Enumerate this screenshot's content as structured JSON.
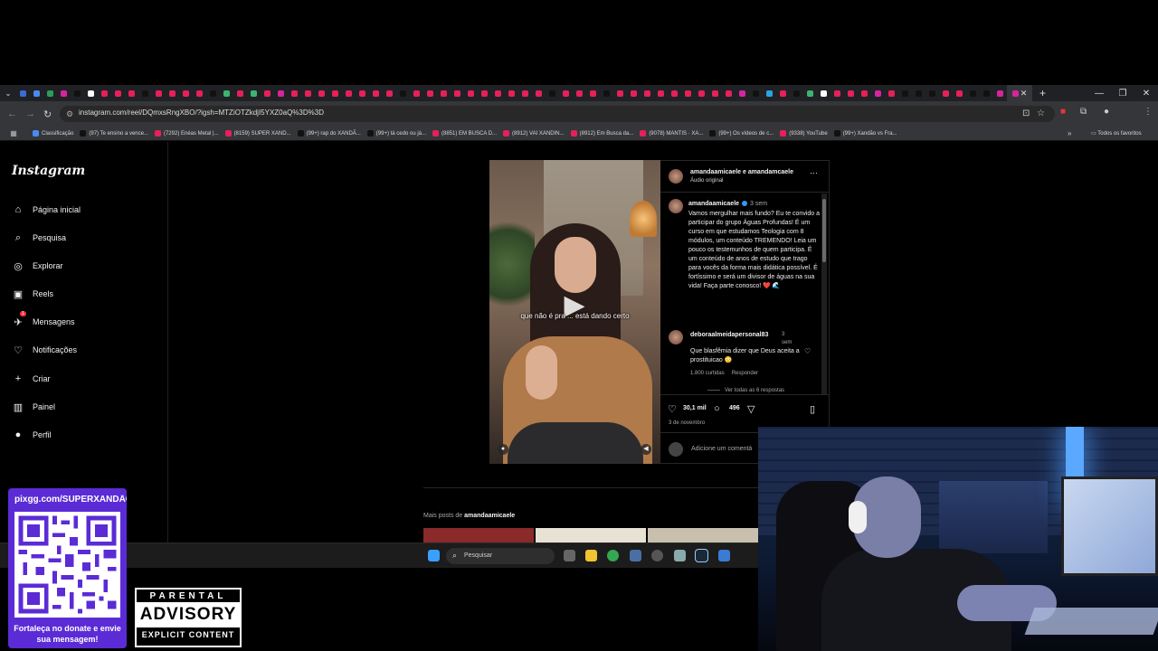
{
  "browser": {
    "url": "instagram.com/reel/DQmxsRngXBO/?igsh=MTZiOTZkdjI5YXZ0aQ%3D%3D",
    "tab_colors": [
      "#3b6bd6",
      "#4a8af4",
      "#2f9a5a",
      "#d6249f",
      "#111",
      "#fff",
      "#e6205a",
      "#e6205a",
      "#e6205a",
      "#111",
      "#e6205a",
      "#e6205a",
      "#e6205a",
      "#e6205a",
      "#111",
      "#3cb371",
      "#e6205a",
      "#3cb371",
      "#e6205a",
      "#d6249f",
      "#e6205a",
      "#e6205a",
      "#e6205a",
      "#e6205a",
      "#e6205a",
      "#e6205a",
      "#e6205a",
      "#e6205a",
      "#111",
      "#e6205a",
      "#e6205a",
      "#e6205a",
      "#e6205a",
      "#e6205a",
      "#e6205a",
      "#e6205a",
      "#e6205a",
      "#e6205a",
      "#e6205a",
      "#111",
      "#e6205a",
      "#e6205a",
      "#e6205a",
      "#111",
      "#e6205a",
      "#e6205a",
      "#e6205a",
      "#e6205a",
      "#e6205a",
      "#e6205a",
      "#e6205a",
      "#e6205a",
      "#e6205a",
      "#d6249f",
      "#111",
      "#2aa4e0",
      "#e6205a",
      "#111",
      "#3cb371",
      "#fff",
      "#e6205a",
      "#e6205a",
      "#e6205a",
      "#d6249f",
      "#e6205a",
      "#111",
      "#111",
      "#111",
      "#e6205a",
      "#e6205a",
      "#111",
      "#111",
      "#d6249f"
    ],
    "bookmarks": [
      {
        "label": "Classificação",
        "color": "#4a8af4"
      },
      {
        "label": "(97) Te ensino a vence...",
        "color": "#111"
      },
      {
        "label": "(7292) Enéas Metal |...",
        "color": "#e6205a"
      },
      {
        "label": "(8159) SUPER XAND...",
        "color": "#e6205a"
      },
      {
        "label": "(99+) rap do XANDÃ...",
        "color": "#111"
      },
      {
        "label": "(99+) tá cedo ou já...",
        "color": "#111"
      },
      {
        "label": "(8851) EM BUSCA D...",
        "color": "#e6205a"
      },
      {
        "label": "(8912) VAI XANDIN...",
        "color": "#e6205a"
      },
      {
        "label": "(8912) Em Busca da...",
        "color": "#e6205a"
      },
      {
        "label": "(9078) MANTIS · XA...",
        "color": "#e6205a"
      },
      {
        "label": "(99+) Os vídeos de c...",
        "color": "#111"
      },
      {
        "label": "(9338) YouTube",
        "color": "#e6205a"
      },
      {
        "label": "(99+) Xandão vs Fra...",
        "color": "#111"
      }
    ],
    "all_bookmarks": "Todos os favoritos"
  },
  "instagram": {
    "logo": "Instagram",
    "nav": [
      {
        "label": "Página inicial",
        "icon": "⌂",
        "icon_name": "home-icon"
      },
      {
        "label": "Pesquisa",
        "icon": "⌕",
        "icon_name": "search-icon"
      },
      {
        "label": "Explorar",
        "icon": "◎",
        "icon_name": "explore-icon"
      },
      {
        "label": "Reels",
        "icon": "▣",
        "icon_name": "reels-icon"
      },
      {
        "label": "Mensagens",
        "icon": "✈",
        "icon_name": "messages-icon"
      },
      {
        "label": "Notificações",
        "icon": "♡",
        "icon_name": "heart-icon"
      },
      {
        "label": "Criar",
        "icon": "+",
        "icon_name": "create-icon"
      },
      {
        "label": "Painel",
        "icon": "▥",
        "icon_name": "dashboard-icon"
      },
      {
        "label": "Perfil",
        "icon": "●",
        "icon_name": "profile-icon"
      }
    ],
    "messages_badge": "1",
    "reel": {
      "subtitle": "que não é pra ... está dando certo"
    },
    "panel": {
      "title": "amandaamicaele e amandamcaele",
      "audio": "Áudio original",
      "caption_user": "amandaamicaele",
      "caption_time": "3 sem",
      "caption": "Vamos mergulhar mais fundo? Eu te convido a participar do grupo Águas Profundas! É um curso em que estudamos Teologia com 8 módulos, um conteúdo TREMENDO! Leia um pouco os testemunhos de quem participa. É um conteúdo de anos de estudo que trago para vocês da forma mais didática possível. É fortíssimo e será um divisor de águas na sua vida! Faça parte conosco! ❤️ 🌊",
      "comment_user": "deboraalmeidapersonal83",
      "comment_time": "3 sem",
      "comment_text": "Que blasfêmia dizer que Deus aceita a prostituicao 😳",
      "comment_likes": "1.800 curtidas",
      "comment_reply": "Responder",
      "view_replies": "Ver todas as 6 respostas",
      "likes": "30,1 mil",
      "comments": "496",
      "date": "3 de novembro",
      "add_comment": "Adicione um comentá"
    },
    "more_posts_prefix": "Mais posts de",
    "more_posts_user": "amandaamicaele"
  },
  "taskbar": {
    "search": "Pesquisar"
  },
  "overlay": {
    "donate_url": "pixgg.com/SUPERXANDÃO",
    "donate_message": "Fortaleça no donate e envie sua mensagem!",
    "advisory_top": "PARENTAL",
    "advisory_mid": "ADVISORY",
    "advisory_bottom": "EXPLICIT CONTENT"
  }
}
